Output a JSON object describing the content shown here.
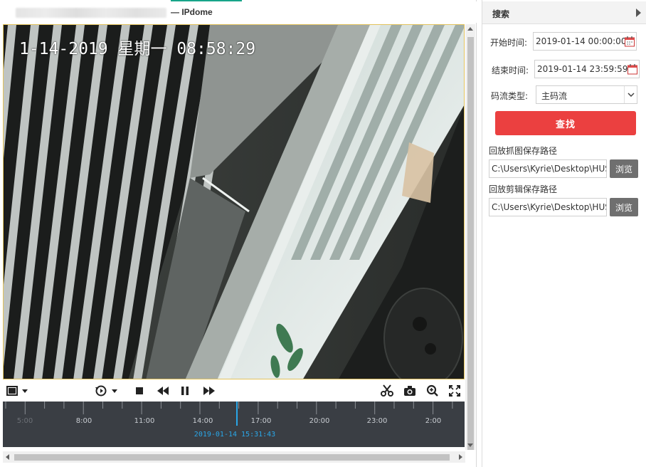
{
  "window": {
    "title": "— IPdome"
  },
  "video": {
    "osd_text": "1-14-2019 星期一 08:58:29"
  },
  "toolbar": {
    "icons": [
      "window-layout-icon",
      "layout-dropdown-icon",
      "playback-mode-icon",
      "playback-dropdown-icon",
      "stop-icon",
      "rewind-icon",
      "pause-icon",
      "fast-forward-icon",
      "clip-icon",
      "snapshot-icon",
      "zoom-icon",
      "fullscreen-icon"
    ]
  },
  "timeline": {
    "labels": [
      "5:00",
      "8:00",
      "11:00",
      "14:00",
      "17:00",
      "20:00",
      "23:00",
      "2:00"
    ],
    "current_time": "2019-01-14 15:31:43"
  },
  "search_panel": {
    "title": "搜索",
    "start_label": "开始时间:",
    "start_value": "2019-01-14 00:00:00",
    "end_label": "结束时间:",
    "end_value": "2019-01-14 23:59:59",
    "stream_label": "码流类型:",
    "stream_value": "主码流",
    "search_button": "查找",
    "snapshot_path_label": "回放抓图保存路径",
    "snapshot_path_value": "C:\\Users\\Kyrie\\Desktop\\HUSV",
    "clip_path_label": "回放剪辑保存路径",
    "clip_path_value": "C:\\Users\\Kyrie\\Desktop\\HUSV",
    "browse_label": "浏览"
  },
  "colors": {
    "accent": "#17a589",
    "search_button": "#eb4040",
    "timeline_bg": "#3a3e44",
    "cursor": "#2aa7e8"
  }
}
